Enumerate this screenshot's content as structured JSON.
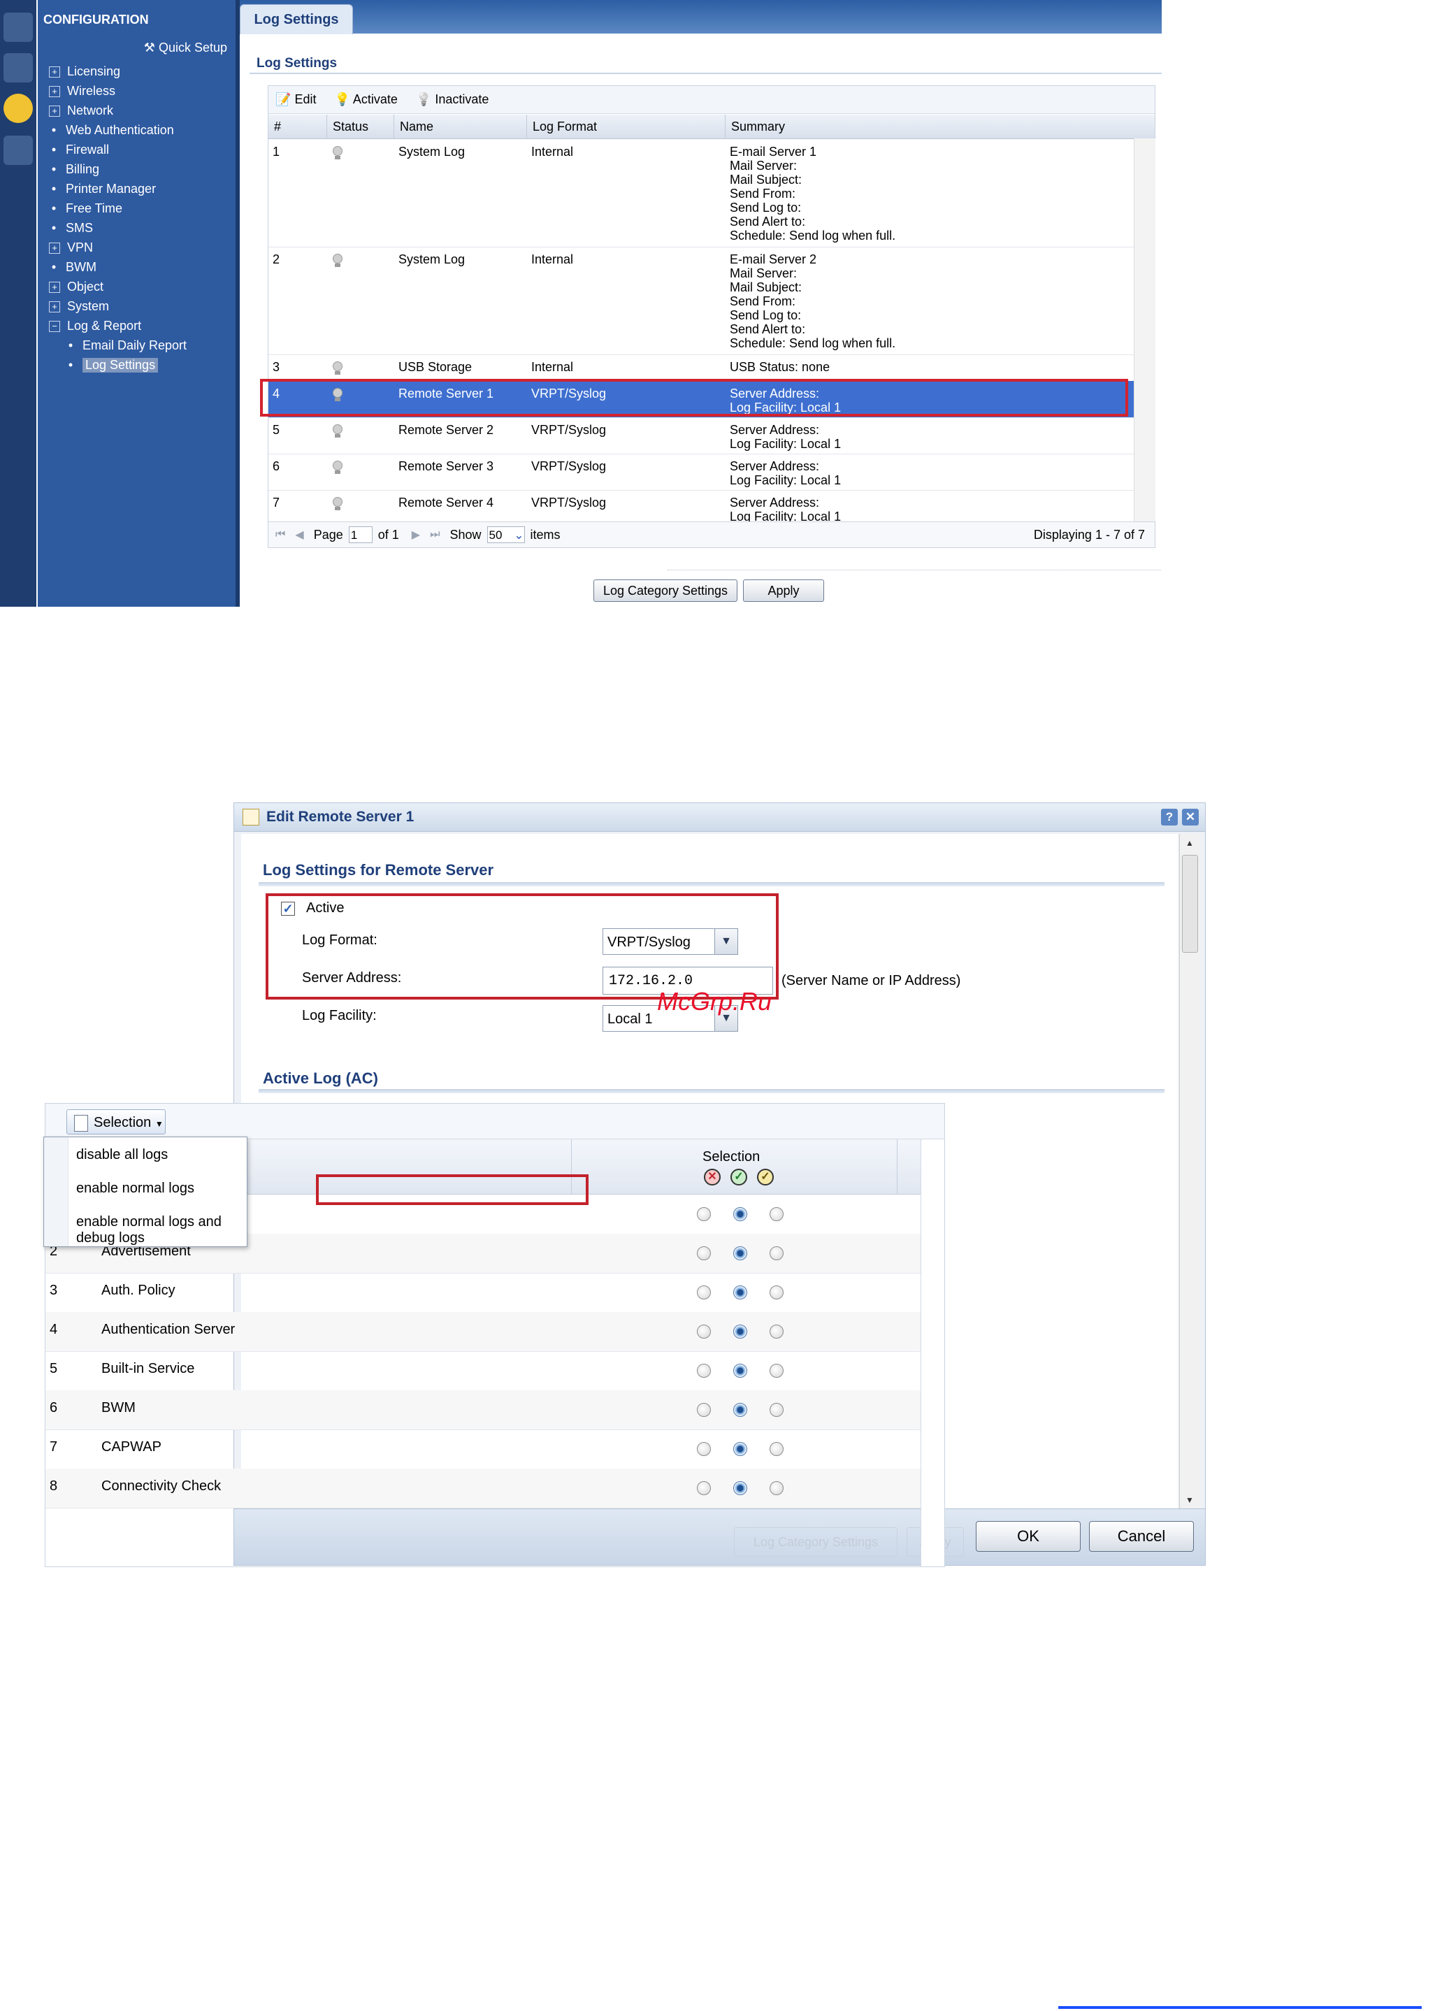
{
  "top_screen": {
    "sidebar": {
      "header": "CONFIGURATION",
      "quick_setup": "Quick Setup",
      "items": [
        {
          "label": "Licensing",
          "marker": "⊞"
        },
        {
          "label": "Wireless",
          "marker": "⊞"
        },
        {
          "label": "Network",
          "marker": "⊞"
        },
        {
          "label": "Web Authentication",
          "marker": "•"
        },
        {
          "label": "Firewall",
          "marker": "•"
        },
        {
          "label": "Billing",
          "marker": "•"
        },
        {
          "label": "Printer Manager",
          "marker": "•"
        },
        {
          "label": "Free Time",
          "marker": "•"
        },
        {
          "label": "SMS",
          "marker": "•"
        },
        {
          "label": "VPN",
          "marker": "⊞"
        },
        {
          "label": "BWM",
          "marker": "•"
        },
        {
          "label": "Object",
          "marker": "⊞"
        },
        {
          "label": "System",
          "marker": "⊞"
        },
        {
          "label": "Log & Report",
          "marker": "⊟"
        }
      ],
      "sub_items": [
        {
          "label": "Email Daily Report"
        },
        {
          "label": "Log Settings",
          "selected": true
        }
      ]
    },
    "tab": "Log Settings",
    "section_title": "Log Settings",
    "toolbar": {
      "edit": "Edit",
      "activate": "Activate",
      "inactivate": "Inactivate"
    },
    "columns": [
      "#",
      "Status",
      "Name",
      "Log Format",
      "Summary"
    ],
    "rows": [
      {
        "num": "1",
        "name": "System Log",
        "format": "Internal",
        "summary": "E-mail Server 1\nMail Server:\nMail Subject:\nSend From:\nSend Log to:\nSend Alert to:\nSchedule: Send log when full."
      },
      {
        "num": "2",
        "name": "System Log",
        "format": "Internal",
        "summary": "E-mail Server 2\nMail Server:\nMail Subject:\nSend From:\nSend Log to:\nSend Alert to:\nSchedule: Send log when full."
      },
      {
        "num": "3",
        "name": "USB Storage",
        "format": "Internal",
        "summary": "USB Status: none"
      },
      {
        "num": "4",
        "name": "Remote Server 1",
        "format": "VRPT/Syslog",
        "summary": "Server Address:\nLog Facility: Local 1",
        "selected": true
      },
      {
        "num": "5",
        "name": "Remote Server 2",
        "format": "VRPT/Syslog",
        "summary": "Server Address:\nLog Facility: Local 1"
      },
      {
        "num": "6",
        "name": "Remote Server 3",
        "format": "VRPT/Syslog",
        "summary": "Server Address:\nLog Facility: Local 1"
      },
      {
        "num": "7",
        "name": "Remote Server 4",
        "format": "VRPT/Syslog",
        "summary": "Server Address:\nLog Facility: Local 1"
      }
    ],
    "pager": {
      "page_label": "Page",
      "page": "1",
      "of": "of 1",
      "show_label": "Show",
      "show": "50",
      "items_label": "items",
      "displaying": "Displaying 1 - 7 of 7"
    },
    "buttons": {
      "log_category": "Log Category Settings",
      "apply": "Apply"
    }
  },
  "dialog": {
    "title": "Edit Remote Server 1",
    "help": "?",
    "close": "✕",
    "section1": "Log Settings for Remote Server",
    "active_label": "Active",
    "active_checked": true,
    "log_format_label": "Log Format:",
    "log_format_value": "VRPT/Syslog",
    "server_address_label": "Server Address:",
    "server_address_value": "172.16.2.0",
    "server_address_hint": "(Server Name or IP Address)",
    "log_facility_label": "Log Facility:",
    "log_facility_value": "Local 1",
    "watermark": "McGrp.Ru",
    "section2": "Active Log (AC)",
    "selection_button": "Selection",
    "selection_header": "Selection",
    "menu": [
      "disable all logs",
      "enable normal logs",
      "enable normal logs and debug logs"
    ],
    "log_rows": [
      {
        "num": "",
        "name": "",
        "selected": 1
      },
      {
        "num": "2",
        "name": "Advertisement",
        "selected": 1
      },
      {
        "num": "3",
        "name": "Auth. Policy",
        "selected": 1
      },
      {
        "num": "4",
        "name": "Authentication Server",
        "selected": 1
      },
      {
        "num": "5",
        "name": "Built-in Service",
        "selected": 1
      },
      {
        "num": "6",
        "name": "BWM",
        "selected": 1
      },
      {
        "num": "7",
        "name": "CAPWAP",
        "selected": 1
      },
      {
        "num": "8",
        "name": "Connectivity Check",
        "selected": 1
      }
    ],
    "footer_ghost": [
      "Log Category Settings",
      "Apply"
    ],
    "ok": "OK",
    "cancel": "Cancel"
  },
  "colors": {
    "highlight": "#d3232f",
    "sidebar": "#2e5aa0",
    "selected_row": "#3e6fd0"
  }
}
